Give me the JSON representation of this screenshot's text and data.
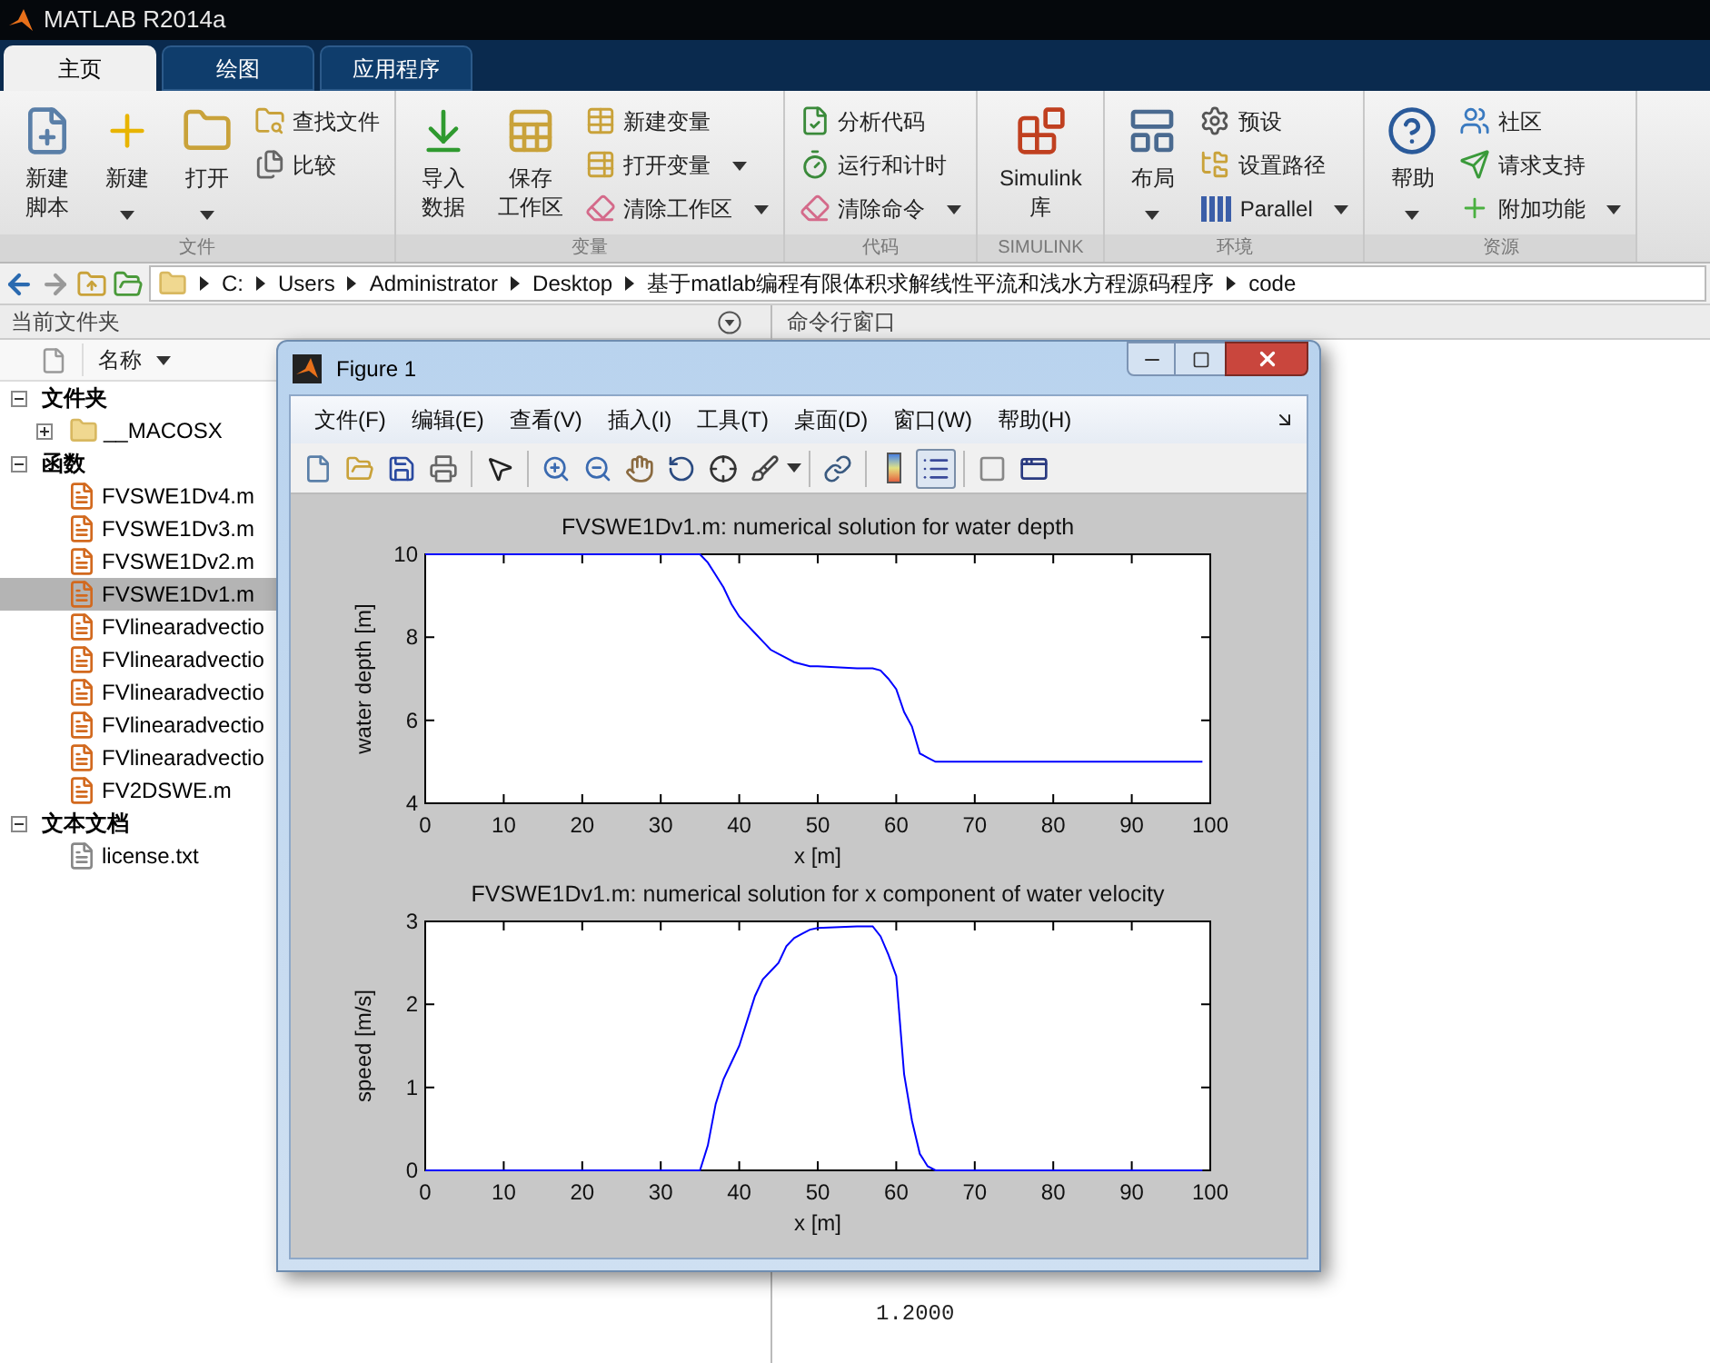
{
  "window": {
    "title": "MATLAB R2014a"
  },
  "tabs": [
    {
      "label": "主页",
      "selected": true
    },
    {
      "label": "绘图",
      "selected": false
    },
    {
      "label": "应用程序",
      "selected": false
    }
  ],
  "toolstrip": [
    {
      "title": "文件",
      "controls": [
        {
          "kind": "large",
          "lines": [
            "新建",
            "脚本"
          ],
          "dropdown": false
        },
        {
          "kind": "large",
          "lines": [
            "新建"
          ],
          "dropdown": true
        },
        {
          "kind": "large",
          "lines": [
            "打开"
          ],
          "dropdown": true
        },
        {
          "kind": "stack",
          "items": [
            {
              "label": "查找文件",
              "dropdown": false
            },
            {
              "label": "比较",
              "dropdown": false
            }
          ]
        }
      ]
    },
    {
      "title": "变量",
      "controls": [
        {
          "kind": "large",
          "lines": [
            "导入",
            "数据"
          ],
          "dropdown": false
        },
        {
          "kind": "large",
          "lines": [
            "保存",
            "工作区"
          ],
          "dropdown": false
        },
        {
          "kind": "stack",
          "items": [
            {
              "label": "新建变量",
              "dropdown": false
            },
            {
              "label": "打开变量",
              "dropdown": true
            },
            {
              "label": "清除工作区",
              "dropdown": true
            }
          ]
        }
      ]
    },
    {
      "title": "代码",
      "controls": [
        {
          "kind": "stack",
          "items": [
            {
              "label": "分析代码",
              "dropdown": false
            },
            {
              "label": "运行和计时",
              "dropdown": false
            },
            {
              "label": "清除命令",
              "dropdown": true
            }
          ]
        }
      ]
    },
    {
      "title": "SIMULINK",
      "controls": [
        {
          "kind": "large",
          "lines": [
            "Simulink",
            "库"
          ],
          "dropdown": false
        }
      ]
    },
    {
      "title": "环境",
      "controls": [
        {
          "kind": "large",
          "lines": [
            "布局"
          ],
          "dropdown": true
        },
        {
          "kind": "stack",
          "items": [
            {
              "label": "预设",
              "dropdown": false
            },
            {
              "label": "设置路径",
              "dropdown": false
            },
            {
              "label": "Parallel",
              "dropdown": true
            }
          ]
        }
      ]
    },
    {
      "title": "资源",
      "controls": [
        {
          "kind": "large",
          "lines": [
            "帮助"
          ],
          "dropdown": true
        },
        {
          "kind": "stack",
          "items": [
            {
              "label": "社区",
              "dropdown": false
            },
            {
              "label": "请求支持",
              "dropdown": false
            },
            {
              "label": "附加功能",
              "dropdown": true
            }
          ]
        }
      ]
    }
  ],
  "path": [
    "C:",
    "Users",
    "Administrator",
    "Desktop",
    "基于matlab编程有限体积求解线性平流和浅水方程源码程序",
    "code"
  ],
  "current_folder": {
    "title": "当前文件夹",
    "column": "名称",
    "groups": [
      {
        "label": "文件夹",
        "expanded": true,
        "children": [
          {
            "label": "__MACOSX",
            "kind": "folder",
            "expanded": false,
            "selected": false
          }
        ]
      },
      {
        "label": "函数",
        "expanded": true,
        "children": [
          {
            "label": "FVSWE1Dv4.m",
            "kind": "function",
            "selected": false
          },
          {
            "label": "FVSWE1Dv3.m",
            "kind": "function",
            "selected": false
          },
          {
            "label": "FVSWE1Dv2.m",
            "kind": "function",
            "selected": false
          },
          {
            "label": "FVSWE1Dv1.m",
            "kind": "function",
            "selected": true
          },
          {
            "label": "FVlinearadvectio",
            "kind": "function",
            "selected": false
          },
          {
            "label": "FVlinearadvectio",
            "kind": "function",
            "selected": false
          },
          {
            "label": "FVlinearadvectio",
            "kind": "function",
            "selected": false
          },
          {
            "label": "FVlinearadvectio",
            "kind": "function",
            "selected": false
          },
          {
            "label": "FVlinearadvectio",
            "kind": "function",
            "selected": false
          },
          {
            "label": "FV2DSWE.m",
            "kind": "function",
            "selected": false
          }
        ]
      },
      {
        "label": "文本文档",
        "expanded": true,
        "children": [
          {
            "label": "license.txt",
            "kind": "text",
            "selected": false
          }
        ]
      }
    ]
  },
  "command_window": {
    "title": "命令行窗口",
    "output": [
      "1.2000"
    ]
  },
  "figure": {
    "title": "Figure 1",
    "menu": [
      "文件(F)",
      "编辑(E)",
      "查看(V)",
      "插入(I)",
      "工具(T)",
      "桌面(D)",
      "窗口(W)",
      "帮助(H)"
    ],
    "toolbar": {
      "legend_on": true
    },
    "charts": [
      {
        "chart_data": {
          "type": "line",
          "title": "FVSWE1Dv1.m: numerical solution for water depth",
          "xlabel": "x [m]",
          "ylabel": "water depth [m]",
          "x": [
            0,
            34,
            35,
            36,
            37,
            38,
            39,
            40,
            41,
            42,
            43,
            44,
            45,
            46,
            47,
            48,
            49,
            50,
            55,
            57,
            58,
            59,
            60,
            61,
            62,
            63,
            64,
            65,
            66,
            99
          ],
          "series": [
            {
              "color": "#0000ff",
              "values": [
                10,
                10,
                10,
                9.8,
                9.5,
                9.2,
                8.8,
                8.5,
                8.3,
                8.1,
                7.9,
                7.7,
                7.6,
                7.5,
                7.4,
                7.35,
                7.3,
                7.3,
                7.25,
                7.25,
                7.2,
                7.0,
                6.75,
                6.2,
                5.85,
                5.2,
                5.1,
                5.0,
                5.0,
                5.0
              ]
            }
          ],
          "xlim": [
            0,
            100
          ],
          "ylim": [
            4,
            10
          ],
          "xticks": [
            0,
            10,
            20,
            30,
            40,
            50,
            60,
            70,
            80,
            90,
            100
          ],
          "yticks": [
            4,
            6,
            8,
            10
          ]
        }
      },
      {
        "chart_data": {
          "type": "line",
          "title": "FVSWE1Dv1.m: numerical solution for x component of water velocity",
          "xlabel": "x [m]",
          "ylabel": "speed [m/s]",
          "x": [
            0,
            34,
            35,
            36,
            37,
            38,
            39,
            40,
            41,
            42,
            43,
            44,
            45,
            46,
            47,
            48,
            49,
            50,
            55,
            57,
            58,
            59,
            60,
            61,
            62,
            63,
            64,
            65,
            66,
            99
          ],
          "series": [
            {
              "color": "#0000ff",
              "values": [
                0,
                0,
                0,
                0.3,
                0.8,
                1.1,
                1.3,
                1.5,
                1.8,
                2.1,
                2.3,
                2.4,
                2.5,
                2.7,
                2.8,
                2.85,
                2.9,
                2.92,
                2.94,
                2.94,
                2.82,
                2.6,
                2.34,
                1.16,
                0.6,
                0.2,
                0.05,
                0,
                0,
                0
              ]
            }
          ],
          "xlim": [
            0,
            100
          ],
          "ylim": [
            0,
            3
          ],
          "xticks": [
            0,
            10,
            20,
            30,
            40,
            50,
            60,
            70,
            80,
            90,
            100
          ],
          "yticks": [
            0,
            1,
            2,
            3
          ]
        }
      }
    ]
  }
}
